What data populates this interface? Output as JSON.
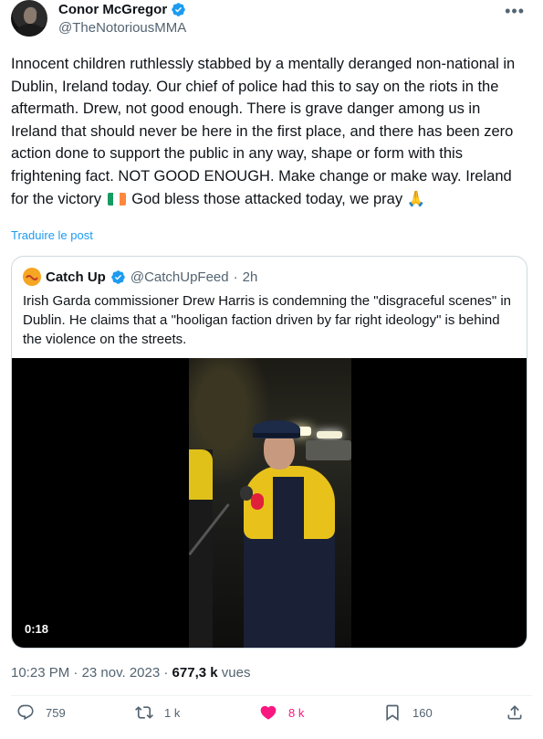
{
  "author": {
    "name": "Conor McGregor",
    "handle": "@TheNotoriousMMA"
  },
  "post": {
    "text_before_flag": "Innocent children ruthlessly stabbed by a mentally deranged non-national in Dublin, Ireland today. Our chief of police had this to say on the riots in the aftermath. Drew, not good enough. There is grave danger among us in Ireland that should never be here in the first place, and there has been zero action done to support the public in any way, shape or form with this frightening fact. NOT GOOD ENOUGH. Make change or make way. Ireland for the victory",
    "text_after_flag": "God bless those attacked today, we pray",
    "emoji_pray": "🙏",
    "translate_label": "Traduire le post"
  },
  "quote": {
    "name": "Catch Up",
    "handle": "@CatchUpFeed",
    "separator": "·",
    "time": "2h",
    "text": "Irish Garda commissioner Drew Harris is condemning the \"disgraceful scenes\" in Dublin. He claims that a \"hooligan faction driven by far right ideology\" is behind the violence on the streets.",
    "video_time": "0:18"
  },
  "meta": {
    "time": "10:23 PM",
    "separator": "·",
    "date": "23 nov. 2023",
    "separator2": "·",
    "views_count": "677,3 k",
    "views_label": "vues"
  },
  "actions": {
    "replies": "759",
    "reposts": "1 k",
    "likes": "8 k",
    "bookmarks": "160"
  },
  "colors": {
    "accent": "#1d9bf0",
    "like": "#f91880",
    "flag_green": "#169b62",
    "flag_white": "#ffffff",
    "flag_orange": "#ff883e"
  }
}
